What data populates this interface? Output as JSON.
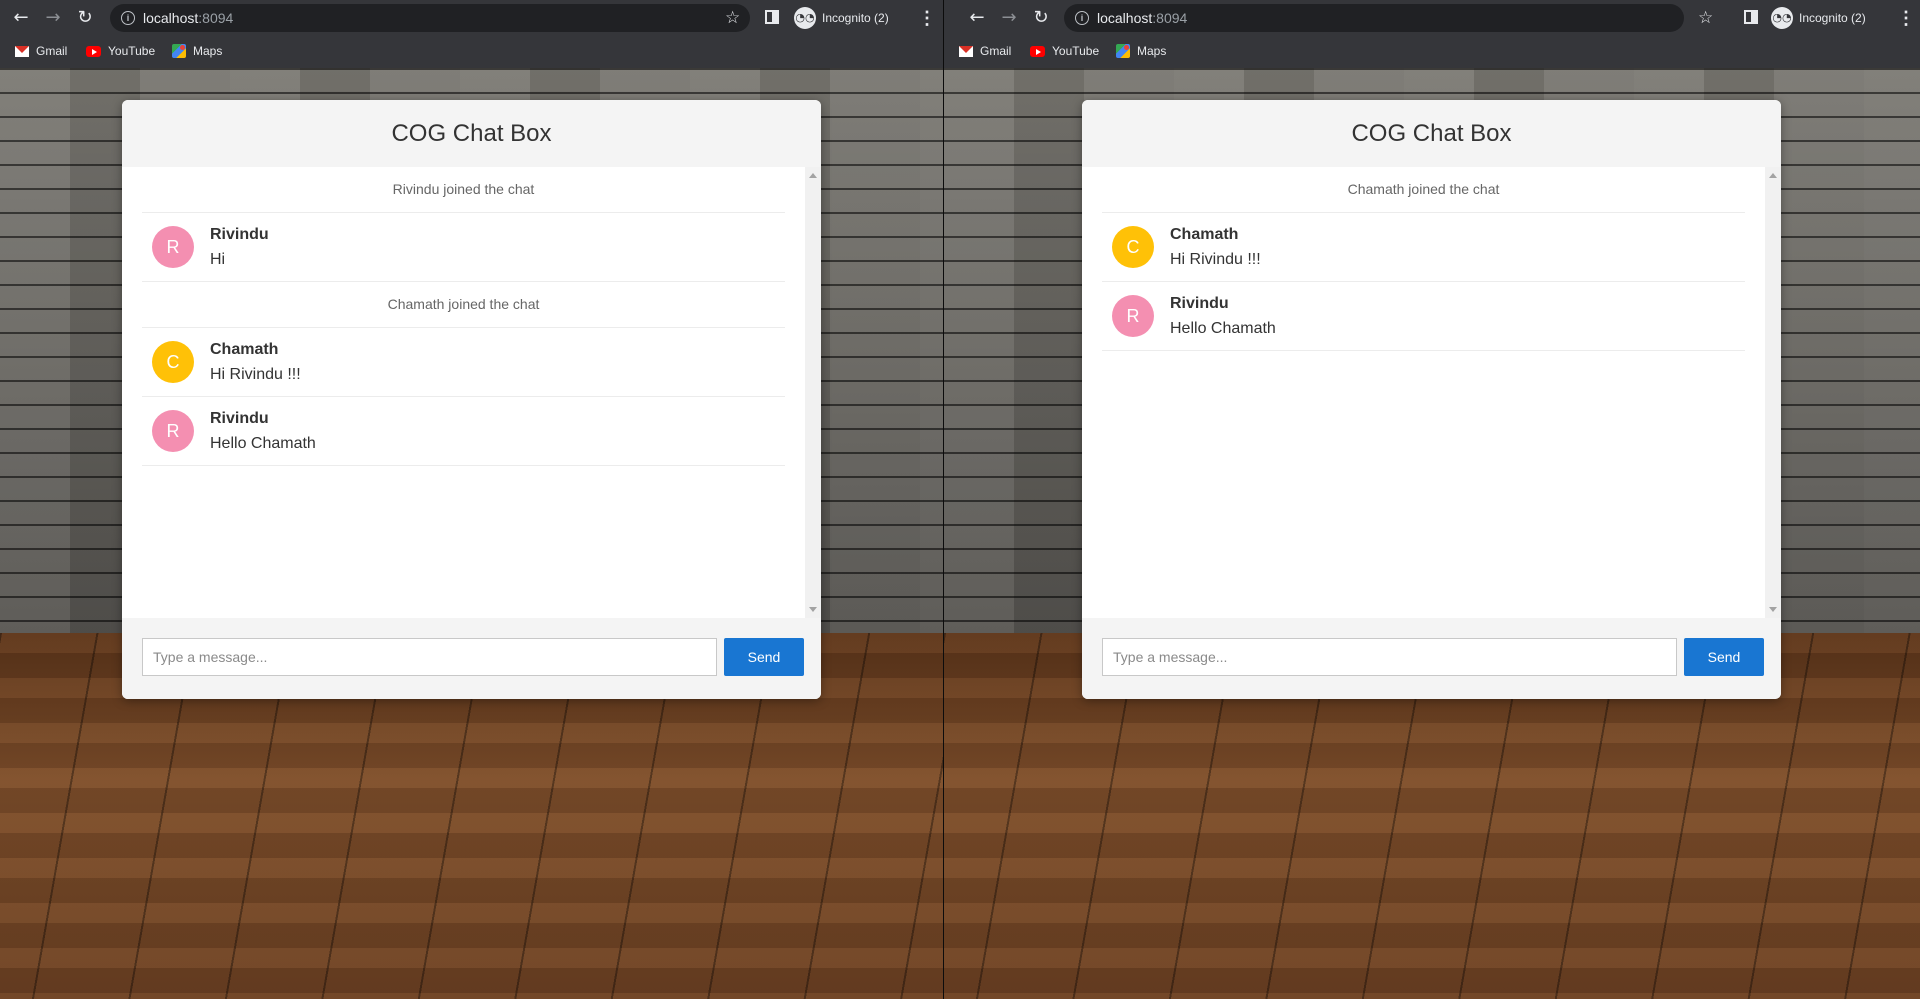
{
  "theme": {
    "accent": "#1976d2",
    "avatar_pink": "#f48fb1",
    "avatar_amber": "#ffc107"
  },
  "windows": [
    {
      "browser": {
        "url_host": "localhost",
        "url_port": ":8094",
        "profile": "Incognito (2)",
        "bookmarks": [
          "Gmail",
          "YouTube",
          "Maps"
        ]
      },
      "chat": {
        "title": "COG Chat Box",
        "events": [
          "Rivindu joined the chat",
          "Chamath joined the chat"
        ],
        "messages": [
          {
            "initial": "R",
            "sender": "Rivindu",
            "text": "Hi"
          },
          {
            "initial": "C",
            "sender": "Chamath",
            "text": "Hi Rivindu !!!"
          },
          {
            "initial": "R",
            "sender": "Rivindu",
            "text": "Hello Chamath"
          }
        ],
        "input_placeholder": "Type a message...",
        "send_label": "Send"
      }
    },
    {
      "browser": {
        "url_host": "localhost",
        "url_port": ":8094",
        "profile": "Incognito (2)",
        "bookmarks": [
          "Gmail",
          "YouTube",
          "Maps"
        ]
      },
      "chat": {
        "title": "COG Chat Box",
        "events": [
          "Chamath joined the chat"
        ],
        "messages": [
          {
            "initial": "C",
            "sender": "Chamath",
            "text": "Hi Rivindu !!!"
          },
          {
            "initial": "R",
            "sender": "Rivindu",
            "text": "Hello Chamath"
          }
        ],
        "input_placeholder": "Type a message...",
        "send_label": "Send"
      }
    }
  ]
}
